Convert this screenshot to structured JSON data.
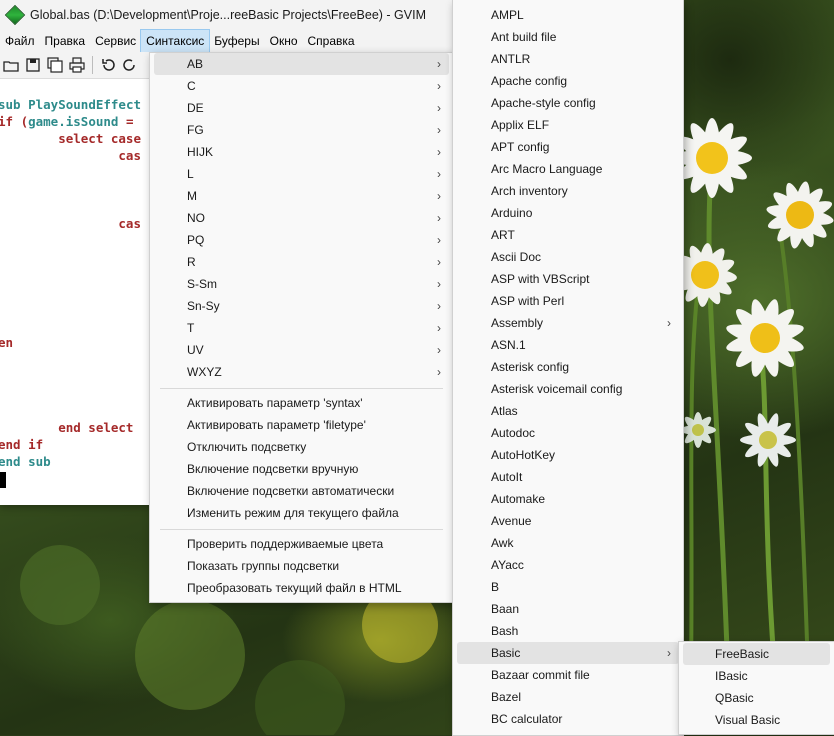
{
  "window": {
    "title": "Global.bas (D:\\Development\\Proje...reeBasic Projects\\FreeBee) - GVIM"
  },
  "menubar": [
    "Файл",
    "Правка",
    "Сервис",
    "Синтаксис",
    "Буферы",
    "Окно",
    "Справка"
  ],
  "toolbar": {
    "icons": [
      "open-icon",
      "save-icon",
      "save-all-icon",
      "print-icon",
      "undo-icon",
      "redo-icon"
    ]
  },
  "editor": {
    "lines": [
      {
        "a": "sub ",
        "b": "PlaySoundEffect"
      },
      {
        "a": "if (",
        "b": "game.isSound",
        "c": " ="
      },
      {
        "a": "        select case"
      },
      {
        "a": "                cas"
      },
      {
        "a": "                cas"
      },
      {
        "a": "en"
      },
      {
        "a": "        end select"
      },
      {
        "a": "end if"
      },
      {
        "a": "end sub"
      }
    ]
  },
  "syntax_menu": {
    "submenus": [
      "AB",
      "C",
      "DE",
      "FG",
      "HIJK",
      "L",
      "M",
      "NO",
      "PQ",
      "R",
      "S-Sm",
      "Sn-Sy",
      "T",
      "UV",
      "WXYZ"
    ],
    "group1": [
      "Активировать параметр 'syntax'",
      "Активировать параметр 'filetype'",
      "Отключить подсветку",
      "Включение подсветки вручную",
      "Включение подсветки автоматически",
      "Изменить режим для текущего файла"
    ],
    "group2": [
      "Проверить поддерживаемые цвета",
      "Показать группы подсветки",
      "Преобразовать текущий файл в HTML"
    ]
  },
  "filetype_menu": {
    "items": [
      "AMPL",
      "Ant build file",
      "ANTLR",
      "Apache config",
      "Apache-style config",
      "Applix ELF",
      "APT config",
      "Arc Macro Language",
      "Arch inventory",
      "Arduino",
      "ART",
      "Ascii Doc",
      "ASP with VBScript",
      "ASP with Perl",
      "Assembly",
      "ASN.1",
      "Asterisk config",
      "Asterisk voicemail config",
      "Atlas",
      "Autodoc",
      "AutoHotKey",
      "AutoIt",
      "Automake",
      "Avenue",
      "Awk",
      "AYacc",
      "B",
      "Baan",
      "Bash",
      "Basic",
      "Bazaar commit file",
      "Bazel",
      "BC calculator"
    ]
  },
  "basic_menu": {
    "items": [
      "FreeBasic",
      "IBasic",
      "QBasic",
      "Visual Basic"
    ]
  },
  "colors": {
    "keyword_red": "#a52a2a",
    "keyword_teal": "#2e8b8b",
    "highlight": "#e3e3e3"
  }
}
